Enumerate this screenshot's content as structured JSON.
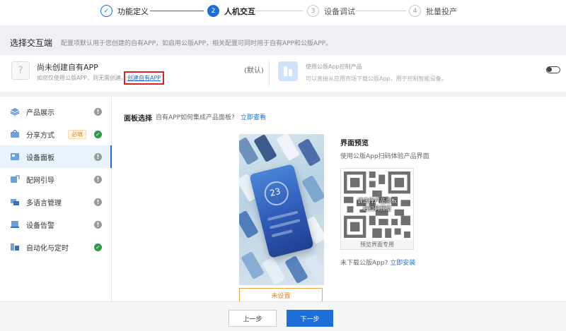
{
  "stepper": {
    "steps": [
      {
        "num": "✓",
        "label": "功能定义",
        "state": "done"
      },
      {
        "num": "2",
        "label": "人机交互",
        "state": "active"
      },
      {
        "num": "3",
        "label": "设备调试",
        "state": "todo"
      },
      {
        "num": "4",
        "label": "批量投产",
        "state": "todo"
      }
    ],
    "colors": {
      "done": "#1b6fd6",
      "todo": "#d0d0d0"
    }
  },
  "select": {
    "title": "选择交互端",
    "desc": "配置项默认用于您创建的自有APP，如启用公版APP，相关配置可同时用于自有APP和公版APP。"
  },
  "own_app": {
    "icon": "question-icon",
    "icon_glyph": "?",
    "title": "尚未创建自有APP",
    "desc": "如您仅使用公版APP，则无需创建。",
    "create_link": "创建自有APP",
    "default_tag": "(默认)"
  },
  "public_app": {
    "icon": "public-app-icon",
    "title": "使用公版App控制产品",
    "desc": "可以直接从应用市场下载公版App，用于控制智能设备。",
    "toggle_on": false
  },
  "sidebar": {
    "items": [
      {
        "label": "产品展示",
        "icon": "product-icon",
        "status": "warn",
        "status_glyph": "!",
        "required": ""
      },
      {
        "label": "分享方式",
        "icon": "share-icon",
        "status": "ok",
        "status_glyph": "✓",
        "required": "必填"
      },
      {
        "label": "设备面板",
        "icon": "panel-icon",
        "status": "warn",
        "status_glyph": "!",
        "required": "",
        "active": true
      },
      {
        "label": "配网引导",
        "icon": "network-icon",
        "status": "warn",
        "status_glyph": "!",
        "required": ""
      },
      {
        "label": "多语言管理",
        "icon": "language-icon",
        "status": "warn",
        "status_glyph": "!",
        "required": ""
      },
      {
        "label": "设备告警",
        "icon": "alarm-icon",
        "status": "warn",
        "status_glyph": "!",
        "required": ""
      },
      {
        "label": "自动化与定时",
        "icon": "automation-icon",
        "status": "ok",
        "status_glyph": "✓",
        "required": ""
      }
    ]
  },
  "panel": {
    "label": "面板选择",
    "question": "自有APP如何集成产品面板?",
    "link": "立即查看",
    "temp": "23",
    "unset": "未设置"
  },
  "preview": {
    "title": "界面预览",
    "desc": "使用公版App扫码体验产品界面",
    "qr_line1": "请选择产品面板",
    "qr_line2": "后扫码预览",
    "qr_caption": "预览界面专用",
    "no_app": "未下载公版App?",
    "install": "立即安装"
  },
  "footer": {
    "prev": "上一步",
    "next": "下一步"
  }
}
